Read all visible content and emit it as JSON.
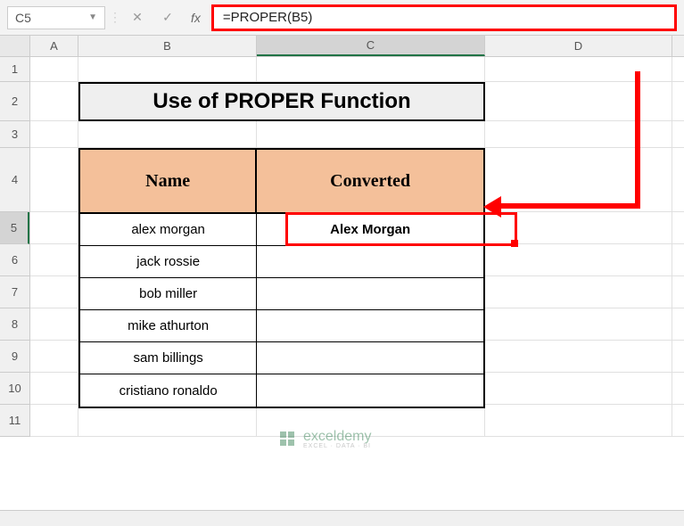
{
  "nameBox": "C5",
  "formula": "=PROPER(B5)",
  "columns": [
    "A",
    "B",
    "C",
    "D"
  ],
  "rows": [
    "1",
    "2",
    "3",
    "4",
    "5",
    "6",
    "7",
    "8",
    "9",
    "10",
    "11"
  ],
  "activeCol": "C",
  "activeRow": "5",
  "title": "Use of PROPER Function",
  "headers": {
    "name": "Name",
    "converted": "Converted"
  },
  "data": [
    {
      "name": "alex morgan",
      "converted": "Alex Morgan"
    },
    {
      "name": "jack rossie",
      "converted": ""
    },
    {
      "name": "bob miller",
      "converted": ""
    },
    {
      "name": "mike athurton",
      "converted": ""
    },
    {
      "name": "sam billings",
      "converted": ""
    },
    {
      "name": "cristiano ronaldo",
      "converted": ""
    }
  ],
  "watermark": {
    "brand": "exceldemy",
    "tag": "EXCEL · DATA · BI"
  },
  "chart_data": {
    "type": "table",
    "title": "Use of PROPER Function",
    "columns": [
      "Name",
      "Converted"
    ],
    "rows": [
      [
        "alex morgan",
        "Alex Morgan"
      ],
      [
        "jack rossie",
        ""
      ],
      [
        "bob miller",
        ""
      ],
      [
        "mike athurton",
        ""
      ],
      [
        "sam billings",
        ""
      ],
      [
        "cristiano ronaldo",
        ""
      ]
    ]
  }
}
